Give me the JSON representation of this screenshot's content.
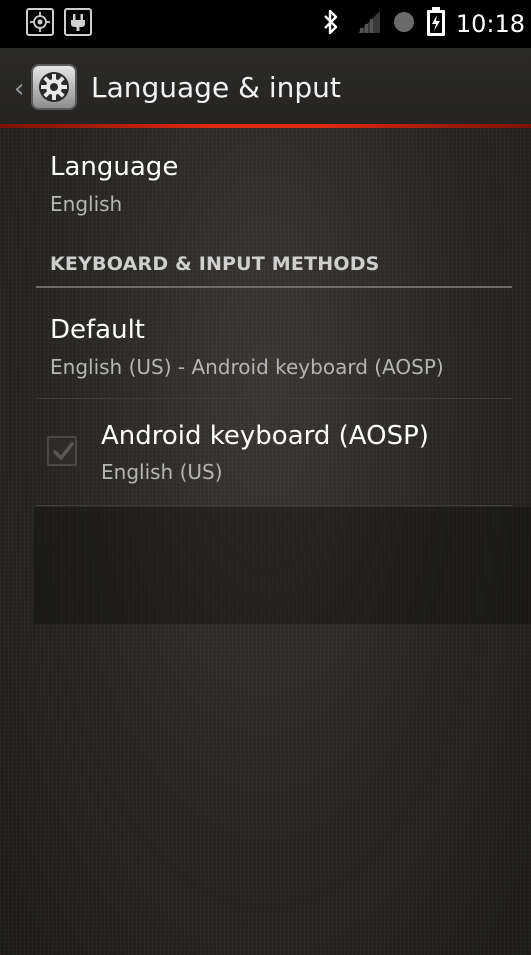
{
  "status_bar": {
    "time": "10:18",
    "left_icons": [
      "gps-icon",
      "usb-icon"
    ],
    "right_icons": [
      "bluetooth-icon",
      "signal-icon",
      "sync-icon",
      "battery-charging-icon"
    ]
  },
  "action_bar": {
    "title": "Language & input",
    "icon": "settings-gear-icon",
    "accent_color": "#e02a10"
  },
  "language": {
    "title": "Language",
    "value": "English"
  },
  "section": {
    "header": "KEYBOARD & INPUT METHODS"
  },
  "default_item": {
    "title": "Default",
    "value": "English (US) - Android keyboard (AOSP)"
  },
  "keyboard_item": {
    "title": "Android keyboard (AOSP)",
    "value": "English (US)",
    "checked": true
  }
}
